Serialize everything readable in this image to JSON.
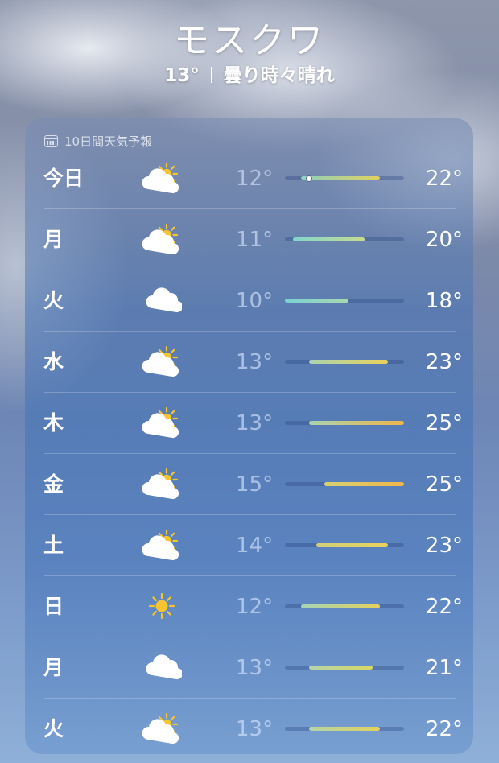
{
  "location": {
    "city": "モスクワ",
    "current_temp": "13°",
    "condition": "曇り時々晴れ"
  },
  "forecast": {
    "title": "10日間天気予報",
    "scale_min": 10,
    "scale_max": 25,
    "days": [
      {
        "day": "今日",
        "icon": "partly-cloudy-icon",
        "low": "12°",
        "high": "22°",
        "low_value": 12,
        "high_value": 22,
        "current": 13,
        "color_from": "#8fd0bf",
        "color_to": "#e2d15c"
      },
      {
        "day": "月",
        "icon": "partly-cloudy-icon",
        "low": "11°",
        "high": "20°",
        "low_value": 11,
        "high_value": 20,
        "color_from": "#80d6cf",
        "color_to": "#c7dc8c"
      },
      {
        "day": "火",
        "icon": "cloud-icon",
        "low": "10°",
        "high": "18°",
        "low_value": 10,
        "high_value": 18,
        "color_from": "#7bd0d3",
        "color_to": "#a8d8b0"
      },
      {
        "day": "水",
        "icon": "partly-cloudy-icon",
        "low": "13°",
        "high": "23°",
        "low_value": 13,
        "high_value": 23,
        "color_from": "#aad3b0",
        "color_to": "#ead15a"
      },
      {
        "day": "木",
        "icon": "partly-cloudy-icon",
        "low": "13°",
        "high": "25°",
        "low_value": 13,
        "high_value": 25,
        "color_from": "#aad3b0",
        "color_to": "#f0b54a"
      },
      {
        "day": "金",
        "icon": "partly-cloudy-icon",
        "low": "15°",
        "high": "25°",
        "low_value": 15,
        "high_value": 25,
        "color_from": "#d8d173",
        "color_to": "#f0b54a"
      },
      {
        "day": "土",
        "icon": "partly-cloudy-icon",
        "low": "14°",
        "high": "23°",
        "low_value": 14,
        "high_value": 23,
        "color_from": "#d0d07a",
        "color_to": "#ead15a"
      },
      {
        "day": "日",
        "icon": "sun-icon",
        "low": "12°",
        "high": "22°",
        "low_value": 12,
        "high_value": 22,
        "color_from": "#a6d4b3",
        "color_to": "#e2d15c"
      },
      {
        "day": "月",
        "icon": "cloud-icon",
        "low": "13°",
        "high": "21°",
        "low_value": 13,
        "high_value": 21,
        "color_from": "#b4d4a8",
        "color_to": "#d8d864"
      },
      {
        "day": "火",
        "icon": "partly-cloudy-icon",
        "low": "13°",
        "high": "22°",
        "low_value": 13,
        "high_value": 22,
        "color_from": "#b4d4a8",
        "color_to": "#e2d15c"
      }
    ]
  }
}
